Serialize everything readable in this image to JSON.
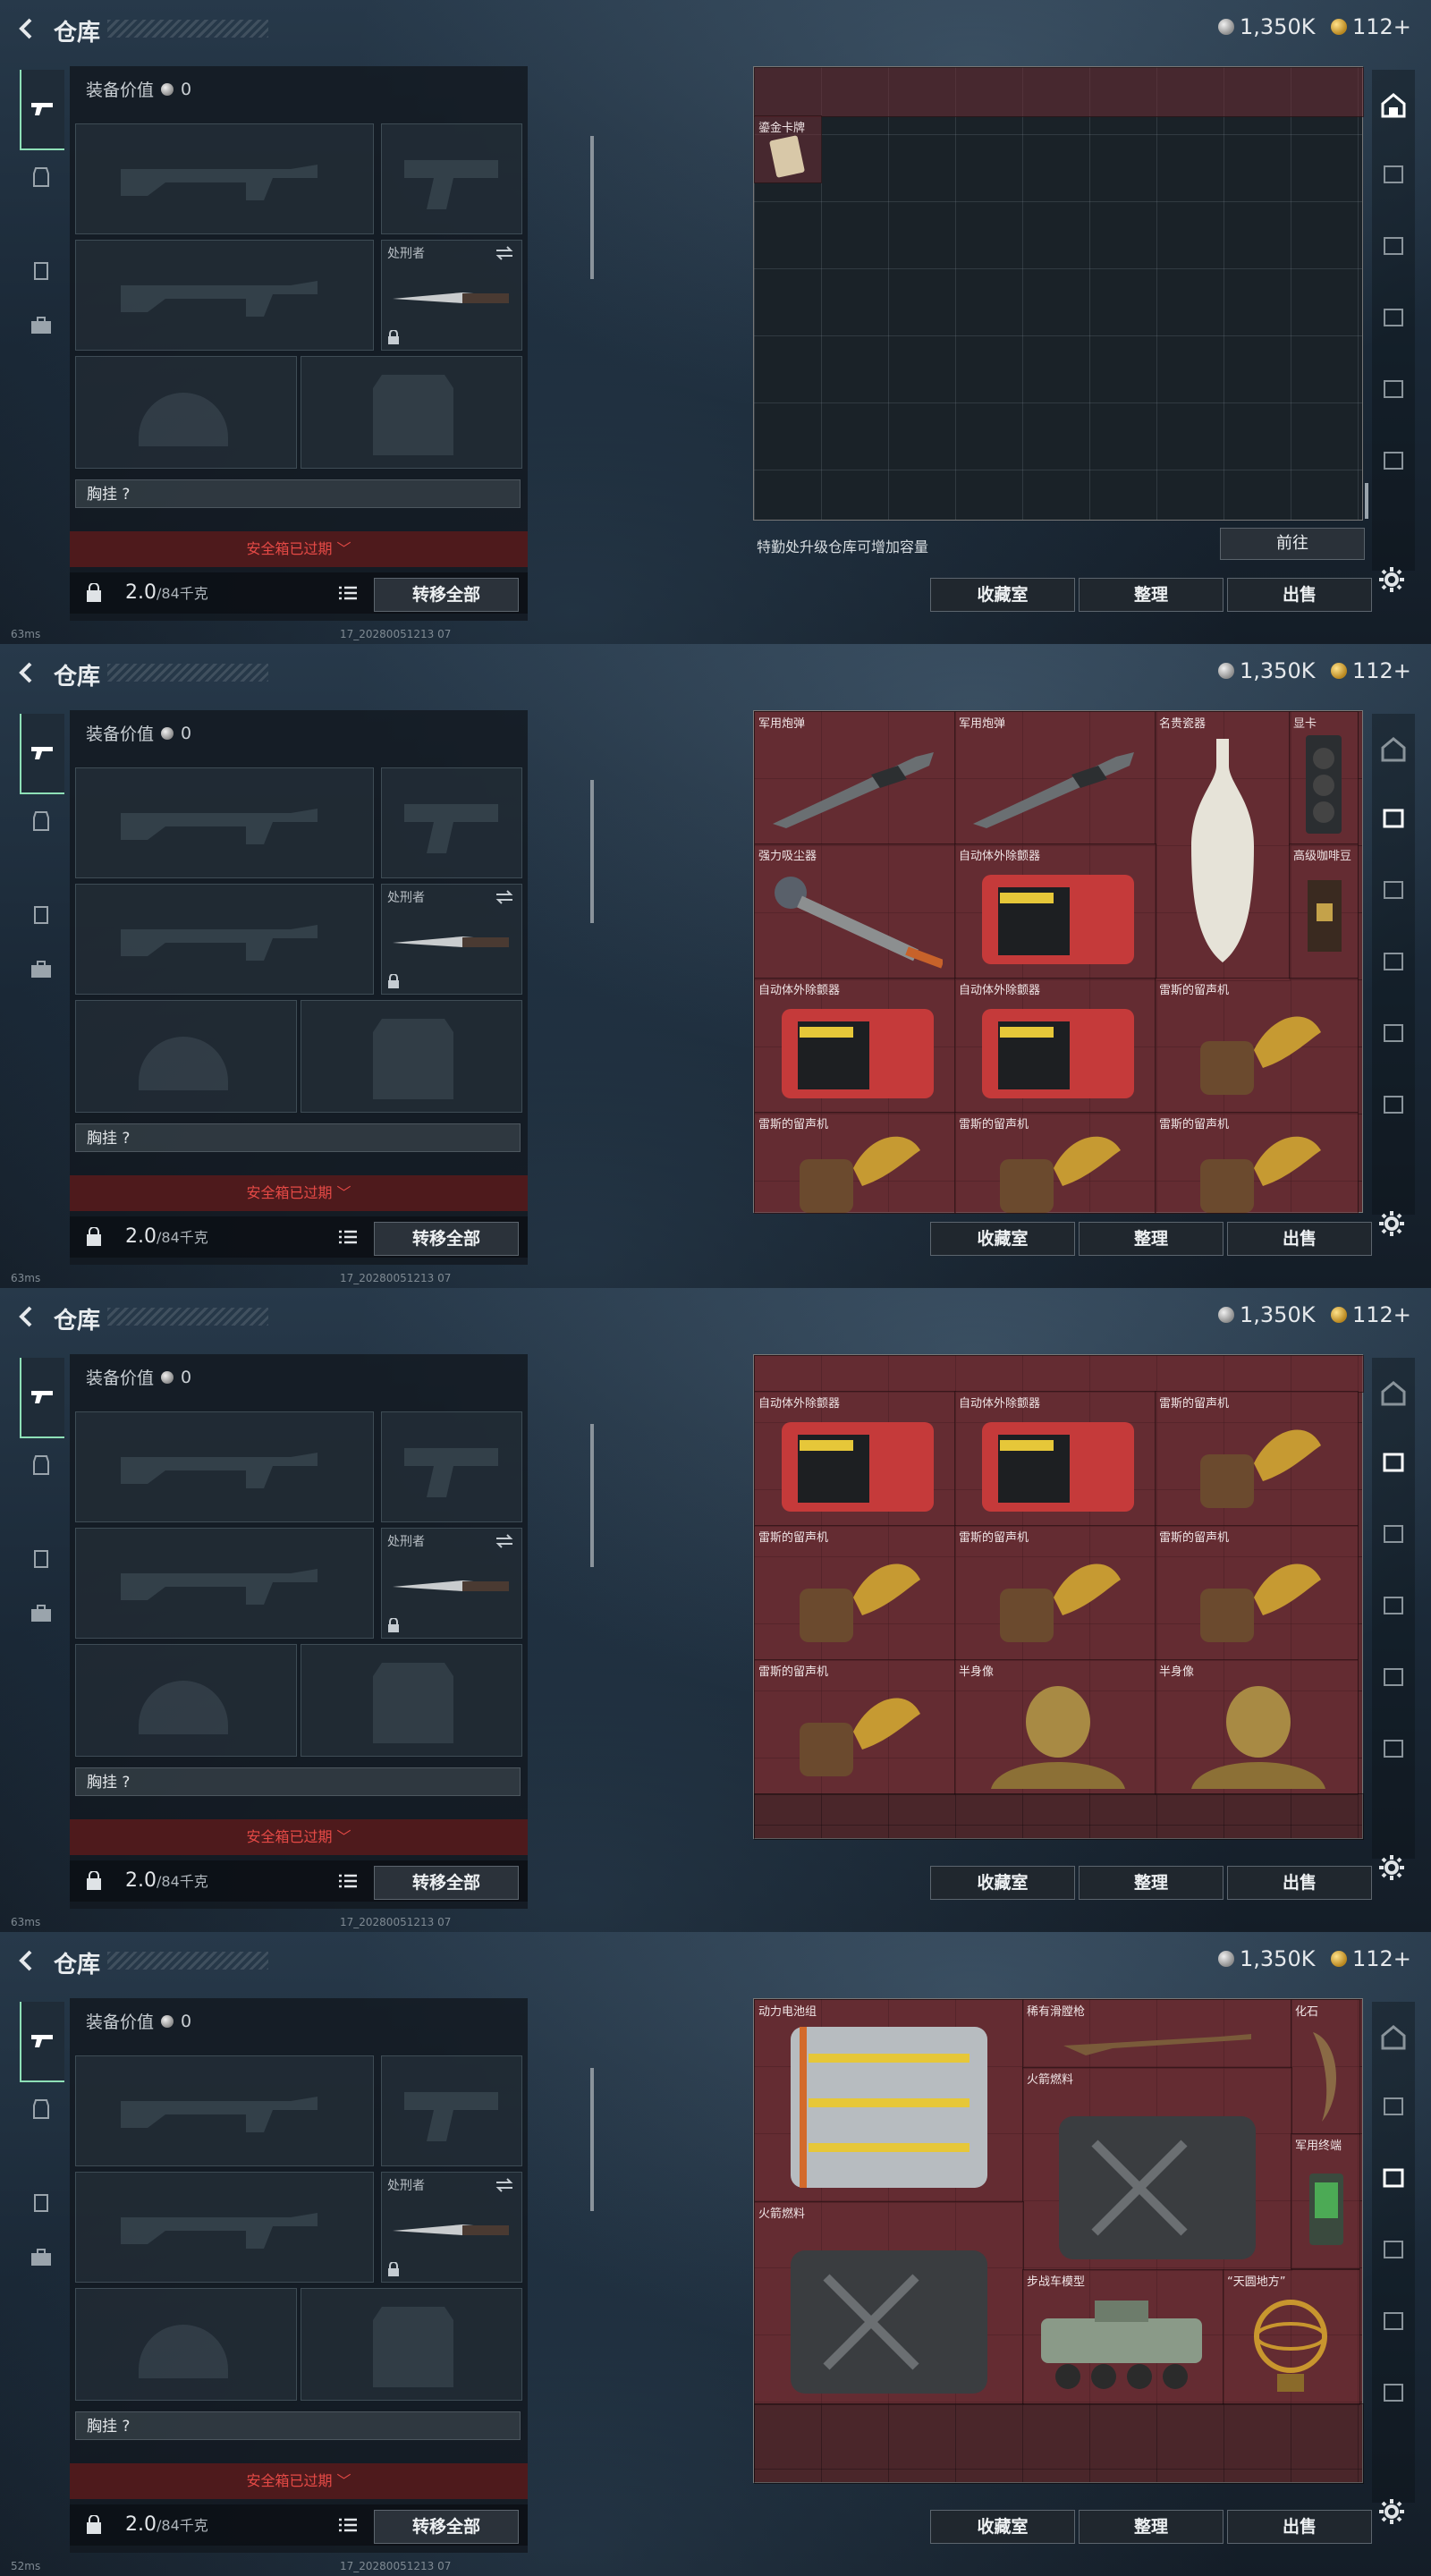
{
  "header": {
    "title": "仓库",
    "silver": "1,350K",
    "gold": "112+"
  },
  "equipment": {
    "value_label": "装备价值",
    "value": "0",
    "melee_label": "处刑者",
    "chest_label": "胸挂 ?",
    "safe_box_text": "安全箱已过期",
    "weight_value": "2.0",
    "weight_cap": "/84千克",
    "transfer_all": "转移全部"
  },
  "warehouse": {
    "hint": "特勤处升级仓库可增加容量",
    "goto_button": "前往",
    "collection_button": "收藏室",
    "sort_button": "整理",
    "sell_button": "出售"
  },
  "status": {
    "ping": "63ms",
    "ping_last": "52ms",
    "build": "17_20280051213 07"
  },
  "screens": [
    {
      "id": "screen1",
      "items": [
        {
          "label": "鎏金卡牌"
        }
      ]
    },
    {
      "id": "screen2",
      "items": [
        {
          "label": "军用炮弹"
        },
        {
          "label": "军用炮弹"
        },
        {
          "label": "名贵瓷器"
        },
        {
          "label": "显卡"
        },
        {
          "label": "强力吸尘器"
        },
        {
          "label": "自动体外除颤器"
        },
        {
          "label": "高级咖啡豆"
        },
        {
          "label": "自动体外除颤器"
        },
        {
          "label": "自动体外除颤器"
        },
        {
          "label": "雷斯的留声机"
        },
        {
          "label": "雷斯的留声机"
        },
        {
          "label": "雷斯的留声机"
        },
        {
          "label": "雷斯的留声机"
        }
      ]
    },
    {
      "id": "screen3",
      "items": [
        {
          "label": "自动体外除颤器"
        },
        {
          "label": "自动体外除颤器"
        },
        {
          "label": "雷斯的留声机"
        },
        {
          "label": "雷斯的留声机"
        },
        {
          "label": "雷斯的留声机"
        },
        {
          "label": "雷斯的留声机"
        },
        {
          "label": "雷斯的留声机"
        },
        {
          "label": "半身像"
        },
        {
          "label": "半身像"
        }
      ]
    },
    {
      "id": "screen4",
      "items": [
        {
          "label": "动力电池组"
        },
        {
          "label": "稀有滑膛枪"
        },
        {
          "label": "化石"
        },
        {
          "label": "火箭燃料"
        },
        {
          "label": "军用终端"
        },
        {
          "label": "火箭燃料"
        },
        {
          "label": "步战车模型"
        },
        {
          "label": "“天圆地方”"
        }
      ]
    }
  ]
}
